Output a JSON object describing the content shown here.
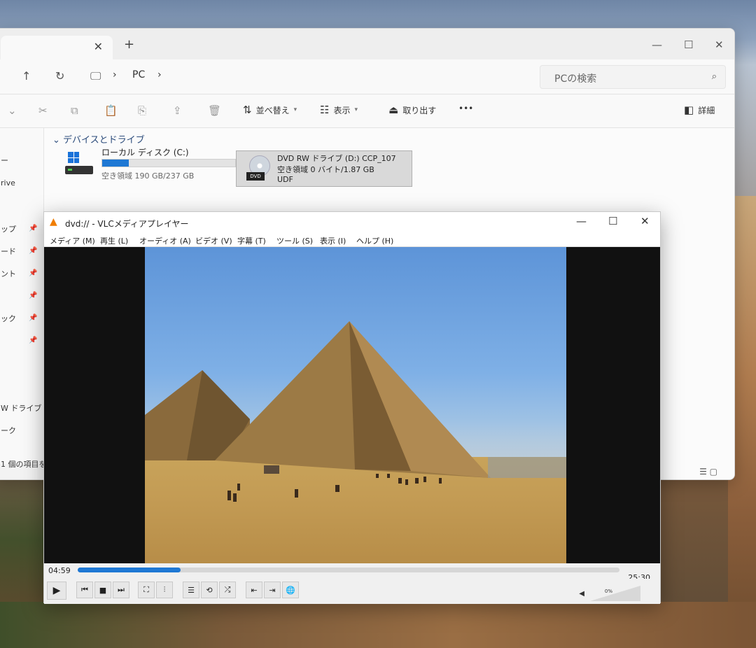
{
  "explorer": {
    "address": {
      "location": "PC"
    },
    "search_placeholder": "PCの検索",
    "toolbar": {
      "sort_label": "並べ替え",
      "view_label": "表示",
      "eject_label": "取り出す",
      "more_label": "•••",
      "details_label": "詳細"
    },
    "sidebar": {
      "items": [
        {
          "label": "ー",
          "pinned": false
        },
        {
          "label": "rive",
          "pinned": false
        },
        {
          "label": "ップ",
          "pinned": true
        },
        {
          "label": "ード",
          "pinned": true
        },
        {
          "label": "ント",
          "pinned": true
        },
        {
          "label": "",
          "pinned": true
        },
        {
          "label": "ック",
          "pinned": true
        },
        {
          "label": "",
          "pinned": true
        },
        {
          "label": "W ドライブ",
          "pinned": false
        },
        {
          "label": "ーク",
          "pinned": false
        }
      ]
    },
    "status_text": "1 個の項目を",
    "section_header": "デバイスとドライブ",
    "drives": [
      {
        "name": "ローカル ディスク (C:)",
        "free": "空き領域 190 GB/237 GB",
        "used_fraction": 0.2
      },
      {
        "name": "DVD RW ドライブ (D:) CCP_107",
        "free": "空き領域 0 バイト/1.87 GB",
        "fs": "UDF",
        "badge": "DVD"
      }
    ]
  },
  "vlc": {
    "title": "dvd:// - VLCメディアプレイヤー",
    "menu": [
      "メディア (M)",
      "再生 (L)",
      "オーディオ (A)",
      "ビデオ (V)",
      "字幕 (T)",
      "ツール (S)",
      "表示 (I)",
      "ヘルプ (H)"
    ],
    "time_elapsed": "04:59",
    "time_total": "25:30",
    "progress_fraction": 0.19,
    "volume_label": "0%",
    "icons": {
      "play": "▶",
      "prev": "⏮",
      "stop": "■",
      "next": "⏭",
      "fullscreen": "⛶",
      "extended": "⫶",
      "playlist": "☰",
      "loop": "⟲",
      "shuffle": "⤮",
      "frame_prev": "⇤",
      "frame_next": "⇥",
      "web": "🌐",
      "speaker": "◀"
    }
  }
}
